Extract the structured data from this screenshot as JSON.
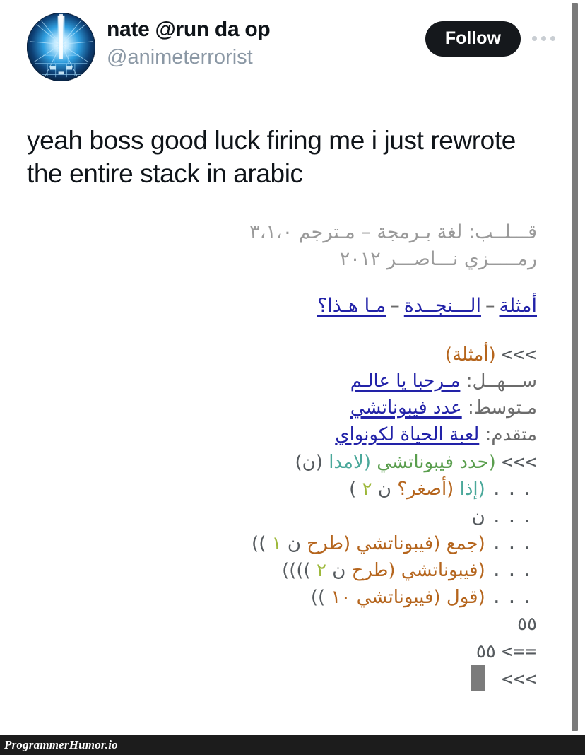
{
  "tweet": {
    "display_name": "nate @run da op",
    "handle": "@animeterrorist",
    "follow_label": "Follow",
    "more_label": "•••",
    "body": "yeah boss good luck firing me i just rewrote the entire stack in arabic"
  },
  "code_shot": {
    "header": {
      "line1": "قـــلــب: لغة بـرمجة – مـترجم ٣،١،٠",
      "line2": "رمـــــزي نـــاصـــر ٢٠١٢"
    },
    "nav": {
      "examples": "أمثلة",
      "help": "الـــنجــدة",
      "what_is_this": "مـا هـذا؟",
      "separator": "–"
    },
    "repl": {
      "prompt": "<<<",
      "continuation": "...",
      "output_arrow": "<==",
      "examples_call": "(أمثلة)",
      "cursor": "█"
    },
    "levels": [
      {
        "label": "ســـهــل:",
        "link": "مـرحبا يا عالـم"
      },
      {
        "label": "مـتوسط:",
        "link": "عدد فيبوناتشي"
      },
      {
        "label": "متقدم:",
        "link": "لعبة الحياة لكونواي"
      }
    ],
    "code_lines": {
      "l1_define": "(حدد",
      "l1_fib": "فيبوناتشي",
      "l1_lambda": "(لامدا",
      "l1_arg": "(ن)",
      "l2_if": "(إذا",
      "l2_smaller": "(أصغر؟",
      "l2_n": "ن",
      "l2_two": "٢",
      "l2_close": ")",
      "l3_n": "ن",
      "l4_add": "(جمع",
      "l4_fib": "(فيبوناتشي",
      "l4_sub": "(طرح",
      "l4_n": "ن",
      "l4_one": "١",
      "l4_close": "))",
      "l5_fib": "(فيبوناتشي",
      "l5_sub": "(طرح",
      "l5_n": "ن",
      "l5_two": "٢",
      "l5_close": "))))",
      "l6_say": "(قول",
      "l6_fib": "(فيبوناتشي",
      "l6_ten": "١٠",
      "l6_close": "))"
    },
    "outputs": {
      "result1": "٥٥",
      "result2": "٥٥"
    }
  },
  "watermark": {
    "text": "ProgrammerHumor.io"
  },
  "colors": {
    "follow_bg": "#15181c",
    "handle_gray": "#8b98a5",
    "link_blue": "#2222a8",
    "header_gray": "#9a9a9a",
    "token_orange": "#b5651d",
    "token_green": "#5a9e4e",
    "token_teal": "#4aa89a",
    "token_olive": "#9db83a",
    "token_gray": "#555a5e",
    "watermark_bg": "#1c1c1c",
    "scrollbar": "#7a7a7a"
  }
}
